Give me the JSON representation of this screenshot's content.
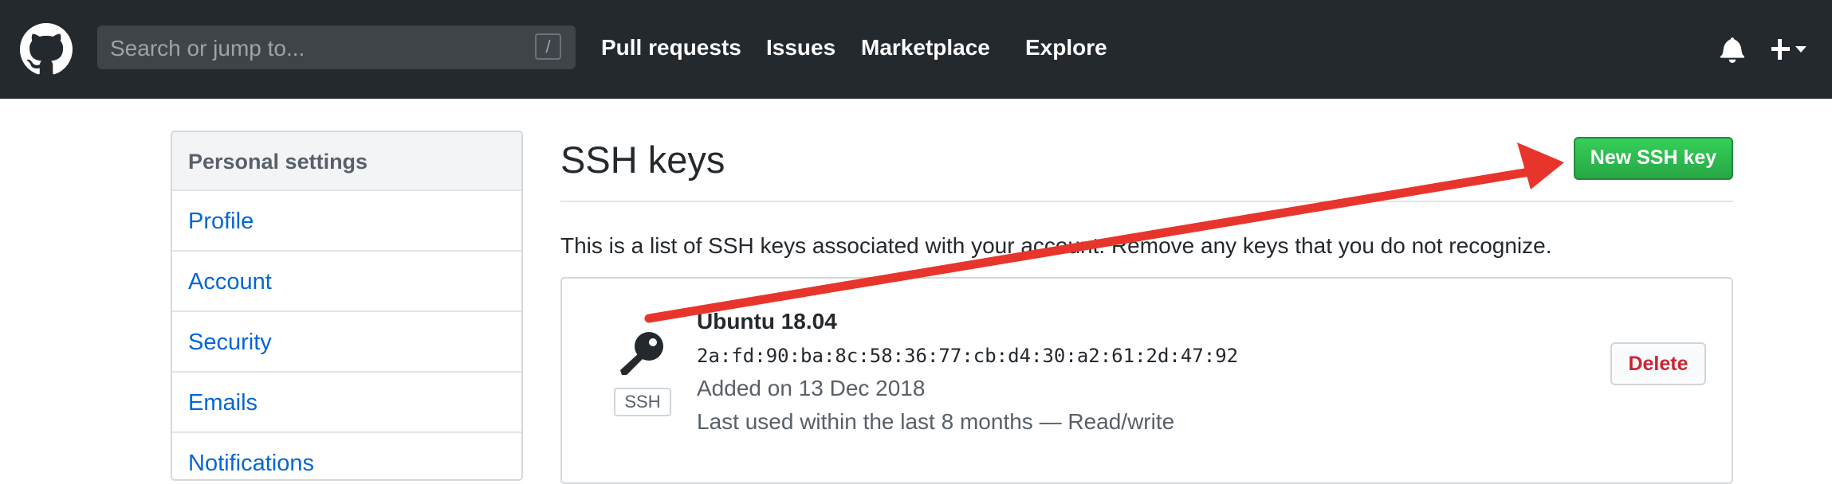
{
  "header": {
    "search_placeholder": "Search or jump to...",
    "search_shortcut": "/",
    "nav": [
      {
        "label": "Pull requests"
      },
      {
        "label": "Issues"
      },
      {
        "label": "Marketplace"
      },
      {
        "label": "Explore"
      }
    ]
  },
  "sidebar": {
    "heading": "Personal settings",
    "items": [
      {
        "label": "Profile"
      },
      {
        "label": "Account"
      },
      {
        "label": "Security"
      },
      {
        "label": "Emails"
      },
      {
        "label": "Notifications"
      }
    ]
  },
  "main": {
    "title": "SSH keys",
    "new_button": "New SSH key",
    "description": "This is a list of SSH keys associated with your account. Remove any keys that you do not recognize.",
    "key": {
      "type_label": "SSH",
      "name": "Ubuntu 18.04",
      "fingerprint": "2a:fd:90:ba:8c:58:36:77:cb:d4:30:a2:61:2d:47:92",
      "added": "Added on 13 Dec 2018",
      "last_used": "Last used within the last 8 months — Read/write",
      "delete_label": "Delete"
    }
  },
  "colors": {
    "header_bg": "#24292e",
    "link": "#0366d6",
    "primary_button": "#28a745",
    "danger": "#cb2431",
    "annotation_arrow": "#e8352b"
  },
  "icons": [
    "github-logo-icon",
    "bell-icon",
    "plus-icon",
    "caret-down-icon",
    "key-icon"
  ]
}
